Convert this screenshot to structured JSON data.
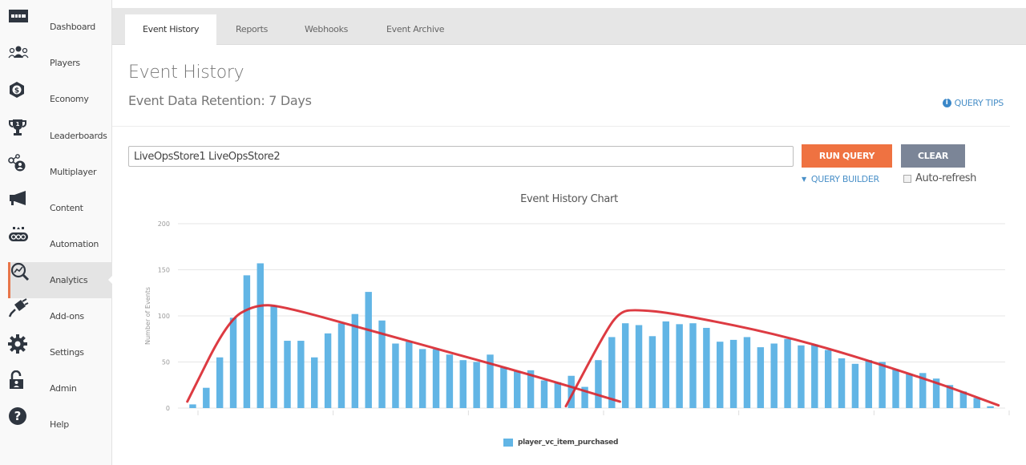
{
  "sidebar": {
    "items": [
      {
        "label": "Dashboard",
        "icon": "dashboard-icon",
        "active": false
      },
      {
        "label": "Players",
        "icon": "players-icon",
        "active": false
      },
      {
        "label": "Economy",
        "icon": "economy-icon",
        "active": false
      },
      {
        "label": "Leaderboards",
        "icon": "trophy-icon",
        "active": false
      },
      {
        "label": "Multiplayer",
        "icon": "multiplayer-icon",
        "active": false
      },
      {
        "label": "Content",
        "icon": "megaphone-icon",
        "active": false
      },
      {
        "label": "Automation",
        "icon": "automation-icon",
        "active": false
      },
      {
        "label": "Analytics",
        "icon": "analytics-icon",
        "active": true
      },
      {
        "label": "Add-ons",
        "icon": "plug-icon",
        "active": false
      },
      {
        "label": "Settings",
        "icon": "gear-icon",
        "active": false
      },
      {
        "label": "Admin",
        "icon": "unlock-icon",
        "active": false
      },
      {
        "label": "Help",
        "icon": "help-icon",
        "active": false
      }
    ]
  },
  "tabs": [
    {
      "label": "Event History",
      "active": true
    },
    {
      "label": "Reports",
      "active": false
    },
    {
      "label": "Webhooks",
      "active": false
    },
    {
      "label": "Event Archive",
      "active": false
    }
  ],
  "header": {
    "title": "Event History",
    "retention": "Event Data Retention: 7 Days",
    "query_tips": "QUERY TIPS"
  },
  "query": {
    "value": "LiveOpsStore1 LiveOpsStore2",
    "run_label": "RUN QUERY",
    "clear_label": "CLEAR",
    "builder_label": "QUERY BUILDER",
    "auto_refresh_label": "Auto-refresh",
    "auto_refresh_checked": false
  },
  "colors": {
    "accent": "#ef7241",
    "clear_button": "#7b8597",
    "link": "#4a90c8",
    "bar": "#62b5e5",
    "annotation": "#d9262e"
  },
  "chart_data": {
    "type": "bar",
    "title": "Event History Chart",
    "xlabel": "",
    "ylabel": "Number of Events",
    "ylim": [
      0,
      200
    ],
    "yticks": [
      0,
      50,
      100,
      150,
      200
    ],
    "grid": true,
    "legend_position": "bottom",
    "series": [
      {
        "name": "player_vc_item_purchased",
        "values": [
          4,
          22,
          55,
          98,
          144,
          157,
          111,
          73,
          73,
          55,
          81,
          92,
          102,
          126,
          95,
          70,
          72,
          64,
          64,
          58,
          52,
          50,
          58,
          44,
          40,
          41,
          30,
          28,
          35,
          23,
          52,
          77,
          92,
          90,
          78,
          94,
          91,
          92,
          87,
          72,
          74,
          77,
          66,
          70,
          75,
          68,
          69,
          63,
          54,
          48,
          52,
          50,
          42,
          37,
          38,
          32,
          25,
          18,
          11,
          2
        ]
      }
    ],
    "annotations": [
      {
        "type": "freehand-trend-curve",
        "color": "#d9262e",
        "points": [
          [
            0,
            7
          ],
          [
            3,
            95
          ],
          [
            5,
            112
          ],
          [
            7,
            111
          ],
          [
            15,
            78
          ],
          [
            25,
            38
          ],
          [
            32,
            7
          ]
        ]
      },
      {
        "type": "freehand-trend-curve",
        "color": "#d9262e",
        "points": [
          [
            28,
            2
          ],
          [
            31,
            85
          ],
          [
            32,
            104
          ],
          [
            33,
            107
          ],
          [
            36,
            103
          ],
          [
            45,
            76
          ],
          [
            55,
            30
          ],
          [
            60,
            3
          ]
        ]
      }
    ]
  }
}
